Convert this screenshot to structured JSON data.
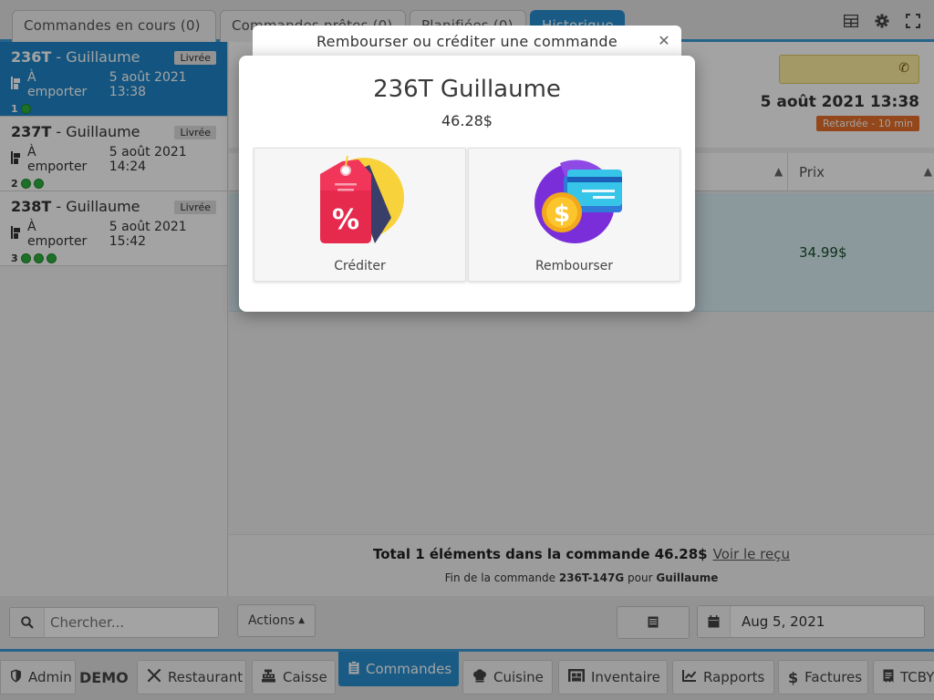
{
  "top_tabs": [
    {
      "label": "Commandes en cours (0)"
    },
    {
      "label": "Commandes prêtes (0)"
    },
    {
      "label": "Planifiées (0)"
    },
    {
      "label": "Historique"
    }
  ],
  "orders": [
    {
      "id": "236T",
      "name": " - Guillaume",
      "status": "Livrée",
      "type": "À emporter",
      "datetime": "5 août 2021 13:38",
      "count": "1"
    },
    {
      "id": "237T",
      "name": " - Guillaume",
      "status": "Livrée",
      "type": "À emporter",
      "datetime": "5 août 2021 14:24",
      "count": "2"
    },
    {
      "id": "238T",
      "name": " - Guillaume",
      "status": "Livrée",
      "type": "À emporter",
      "datetime": "5 août 2021 15:42",
      "count": "3"
    }
  ],
  "detail": {
    "date": "5 août 2021 13:38",
    "late_badge": "Retardée - 10 min",
    "col_price": "Prix",
    "item_price": "34.99$",
    "total_text": "Total 1 éléments dans la commande 46.28$",
    "receipt_link": "Voir le reçu",
    "end_prefix": "Fin de la commande ",
    "end_id": "236T-147G",
    "end_mid": " pour ",
    "end_name": "Guillaume"
  },
  "toolbar": {
    "search_placeholder": "Chercher...",
    "actions_label": "Actions",
    "date_value": "Aug 5, 2021"
  },
  "nav": {
    "admin": "Admin",
    "demo": "DEMO",
    "restaurant": "Restaurant",
    "caisse": "Caisse",
    "commandes": "Commandes",
    "cuisine": "Cuisine",
    "inventaire": "Inventaire",
    "rapports": "Rapports",
    "factures": "Factures",
    "tcby": "TCBY"
  },
  "modal": {
    "title": "Rembourser ou créditer une commande",
    "order_name": "236T Guillaume",
    "amount": "46.28$",
    "credit_label": "Créditer",
    "refund_label": "Rembourser"
  },
  "colors": {
    "accent": "#2a8fd0",
    "selected_order": "#1f86c8",
    "late_badge": "#e8702a",
    "status_dot": "#2fae3f"
  }
}
